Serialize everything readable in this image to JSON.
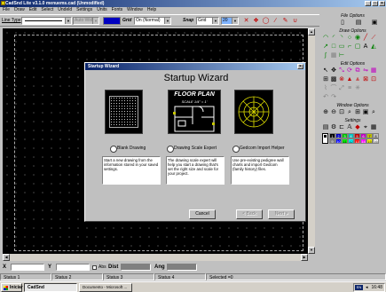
{
  "window": {
    "title": "CadSnd Lite v3.1.0 menuems.cad (Unmodified)",
    "min": "_",
    "max": "□",
    "close": "×"
  },
  "menu": [
    "File",
    "Draw",
    "Edit",
    "Select",
    "Undeld",
    "Settings",
    "Units",
    "Fonts",
    "Window",
    "Help"
  ],
  "toolbar": {
    "line_type_label": "Line Type",
    "auto_width": "Auto Width",
    "grid_label": "Grid",
    "grid_value": "On (Normal)",
    "snap_label": "Snap",
    "snap_value": "Grid",
    "snap_extra": "20",
    "icons": [
      "x-icon",
      "shapes-icon",
      "circle-icon",
      "slash-icon",
      "pencil-icon",
      "magnet-icon"
    ]
  },
  "panel": {
    "file_options": "File Options",
    "draw_options": "Draw Options",
    "edit_options": "Edit Options",
    "window_options": "Window Options",
    "settings": "Settings",
    "colors": [
      "#000000",
      "#0000c0",
      "#00c000",
      "#00c0c0",
      "#c00000",
      "#c000c0",
      "#c0c000",
      "#c0c0c0",
      "#808080",
      "#0000ff",
      "#00ff00",
      "#00ffff",
      "#ff0000",
      "#ff00ff",
      "#ffff00",
      "#ffffff"
    ],
    "color_numbers": [
      "1",
      "2",
      "3",
      "4",
      "5",
      "6",
      "7",
      "8",
      "9",
      "10",
      "11",
      "12",
      "13",
      "14",
      "15",
      "16"
    ]
  },
  "coords": {
    "x_label": "X",
    "y_label": "Y",
    "abs_label": "Abs",
    "dist_label": "Dist",
    "ang_label": "Ang"
  },
  "status": [
    "Status 1",
    "Status 2",
    "Status 3",
    "Status 4",
    "Selected =0"
  ],
  "taskbar": {
    "start": "Iniciar",
    "tasks": [
      "CadSnd",
      "Documento - Microsoft ..."
    ],
    "lang": "EN",
    "clock": "16:48"
  },
  "dialog": {
    "title": "Startup Wizard",
    "heading": "Startup Wizard",
    "close": "×",
    "floorplan_title": "FLOOR PLAN",
    "floorplan_scale": "SCALE 1/4\" = 1'",
    "options": [
      {
        "label": "Blank Drawing",
        "desc": "Start a new drawing from the information stored in your saved settings."
      },
      {
        "label": "Drawing Scale Expert",
        "desc": "The drawing scale expert will help you start a drawing that's set the right size and scale for your project."
      },
      {
        "label": "Gedcom Import Helper",
        "desc": "Use pre-existing pedigree wall charts and import Gedcom (family history) files."
      }
    ],
    "cancel": "Cancel",
    "back": "< Back",
    "next": "Next >"
  }
}
